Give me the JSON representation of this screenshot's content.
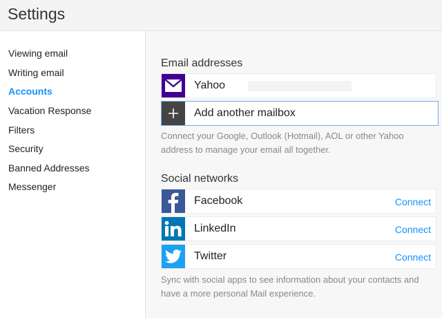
{
  "header": {
    "title": "Settings"
  },
  "sidebar": {
    "items": [
      {
        "label": "Viewing email",
        "active": false
      },
      {
        "label": "Writing email",
        "active": false
      },
      {
        "label": "Accounts",
        "active": true
      },
      {
        "label": "Vacation Response",
        "active": false
      },
      {
        "label": "Filters",
        "active": false
      },
      {
        "label": "Security",
        "active": false
      },
      {
        "label": "Banned Addresses",
        "active": false
      },
      {
        "label": "Messenger",
        "active": false
      }
    ]
  },
  "email": {
    "heading": "Email addresses",
    "yahoo_label": "Yahoo",
    "add_label": "Add another mailbox",
    "help": "Connect your Google, Outlook (Hotmail), AOL or other Yahoo address to manage your email all together."
  },
  "social": {
    "heading": "Social networks",
    "networks": [
      {
        "name": "Facebook",
        "action": "Connect",
        "icon": "facebook-icon",
        "color": "#3b5998"
      },
      {
        "name": "LinkedIn",
        "action": "Connect",
        "icon": "linkedin-icon",
        "color": "#0077b5"
      },
      {
        "name": "Twitter",
        "action": "Connect",
        "icon": "twitter-icon",
        "color": "#1da1f2"
      }
    ],
    "help": "Sync with social apps to see information about your contacts and have a more personal Mail experience."
  },
  "colors": {
    "accent": "#188fff",
    "yahoo": "#410093",
    "add_icon_bg": "#444444"
  }
}
